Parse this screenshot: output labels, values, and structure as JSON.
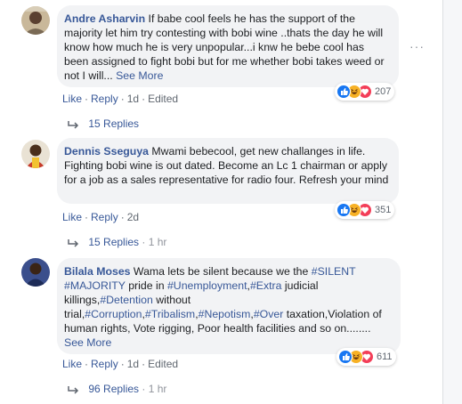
{
  "comments": [
    {
      "author": "Andre Asharvin",
      "text": "If babe cool feels he has the support of the majority let him try contesting with bobi wine ..thats the day he will know how much he is very unpopular...i knw he bebe cool has been assigned to fight bobi but for me whether bobi takes weed or not I will...",
      "see_more": "See More",
      "like": "Like",
      "reply": "Reply",
      "time": "1d",
      "edited": "Edited",
      "reaction_count": "207",
      "replies": "15 Replies",
      "replies_time": "",
      "options_icon": "more-dots-icon"
    },
    {
      "author": "Dennis Sseguya",
      "text": "Mwami bebecool, get new challanges in life. Fighting bobi wine is out dated. Become an Lc 1 chairman or apply for a job as a sales representative for radio four. Refresh your mind",
      "like": "Like",
      "reply": "Reply",
      "time": "2d",
      "reaction_count": "351",
      "replies": "15 Replies",
      "replies_time": "1 hr"
    },
    {
      "author": "Bilala Moses",
      "text_parts": [
        "Wama lets be silent because we the ",
        "#SILENT",
        " ",
        "#MAJORITY",
        " pride in ",
        "#Unemployment",
        ",",
        "#Extra",
        " judicial killings,",
        "#Detention",
        " without trial,",
        "#Corruption",
        ",",
        "#Tribalism",
        ",",
        "#Nepotism",
        ",",
        "#Over",
        " taxation,Violation of human rights, Vote rigging, Poor health facilities and so on........"
      ],
      "see_more": "See More",
      "like": "Like",
      "reply": "Reply",
      "time": "1d",
      "edited": "Edited",
      "reaction_count": "611",
      "replies": "96 Replies",
      "replies_time": "1 hr"
    }
  ],
  "colors": {
    "link": "#385898",
    "bubble": "#f2f3f5",
    "meta": "#606770",
    "like": "#1877f2",
    "haha": "#f7b125",
    "love": "#f33e58"
  },
  "icons": {
    "reply_arrow": "reply-arrow-icon",
    "like": "like-reaction-icon",
    "haha": "haha-reaction-icon",
    "love": "love-reaction-icon"
  }
}
